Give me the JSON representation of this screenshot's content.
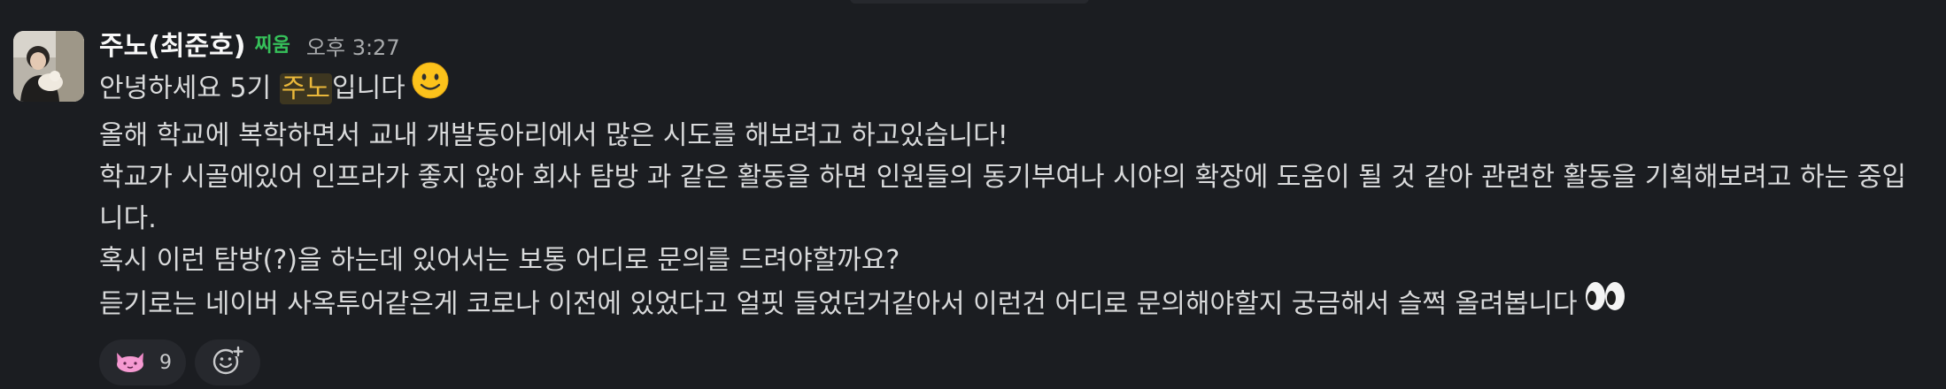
{
  "message": {
    "sender": "주노(최준호)",
    "status_icon": "huddle-headphones-icon",
    "status_text": "찌움",
    "timestamp": "오후 3:27",
    "mention": "주노",
    "line1_before": "안녕하세요 5기 ",
    "line1_after": "입니다",
    "line1_emoji": "slightly-smiling-face-icon",
    "line2": "올해 학교에 복학하면서 교내 개발동아리에서 많은 시도를 해보려고 하고있습니다!",
    "line3": "학교가 시골에있어 인프라가 좋지 않아 회사 탐방 과 같은 활동을 하면 인원들의 동기부여나 시야의 확장에 도움이 될 것 같아 관련한 활동을 기획해보려고 하는 중입니다.",
    "line4": "혹시 이런 탐방(?)을 하는데 있어서는 보통 어디로 문의를 드려야할까요?",
    "line5": "듣기로는 네이버 사옥투어같은게 코로나 이전에 있었다고 얼핏 들었던거같아서 이런건 어디로 문의해야할지 궁금해서 슬쩍 올려봅니다",
    "line5_emoji": "eyes-icon"
  },
  "reactions": [
    {
      "emoji": "pink-cat-icon",
      "count": "9"
    }
  ],
  "add_reaction_icon": "add-reaction-icon",
  "colors": {
    "background": "#1b1d21",
    "mention_bg": "#3d3620",
    "mention_text": "#eab83a",
    "status_green": "#36c05a"
  }
}
